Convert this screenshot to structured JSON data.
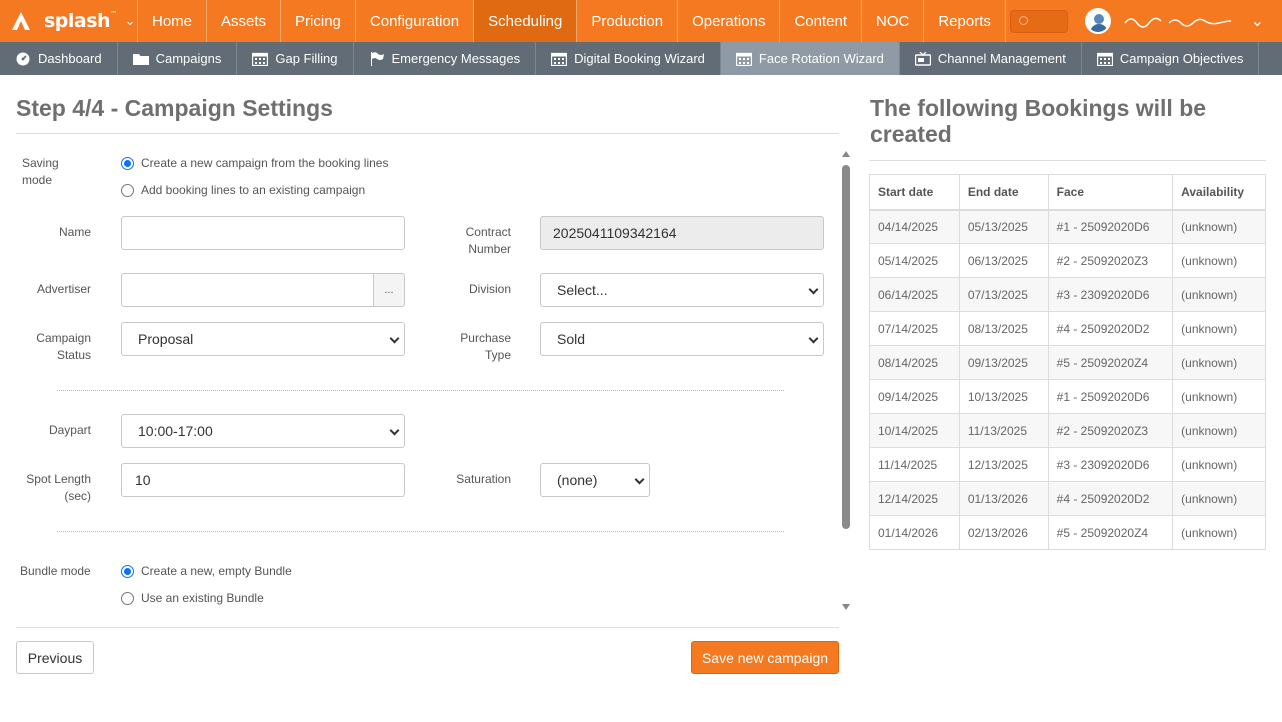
{
  "brand": {
    "name": "splash",
    "trademark": "™"
  },
  "top_nav": [
    "Home",
    "Assets",
    "Pricing",
    "Configuration",
    "Scheduling",
    "Production",
    "Operations",
    "Content",
    "NOC",
    "Reports"
  ],
  "top_nav_active": "Scheduling",
  "sub_nav": [
    {
      "label": "Dashboard",
      "icon": "dashboard-icon"
    },
    {
      "label": "Campaigns",
      "icon": "folder-icon"
    },
    {
      "label": "Gap Filling",
      "icon": "calendar-icon"
    },
    {
      "label": "Emergency Messages",
      "icon": "flag-icon"
    },
    {
      "label": "Digital Booking Wizard",
      "icon": "calendar-icon"
    },
    {
      "label": "Face Rotation Wizard",
      "icon": "calendar-icon"
    },
    {
      "label": "Channel Management",
      "icon": "tv-icon"
    },
    {
      "label": "Campaign Objectives",
      "icon": "calendar-icon"
    }
  ],
  "sub_nav_active": "Face Rotation Wizard",
  "form": {
    "title": "Step 4/4 - Campaign Settings",
    "saving_mode_label": "Saving mode",
    "saving_mode_options": [
      "Create a new campaign from the booking lines",
      "Add booking lines to an existing campaign"
    ],
    "saving_mode_selected": 0,
    "name_label": "Name",
    "name_value": "",
    "contract_number_label_1": "Contract",
    "contract_number_label_2": "Number",
    "contract_number_value": "2025041109342164",
    "advertiser_label": "Advertiser",
    "advertiser_value": "",
    "advertiser_browse": "...",
    "division_label": "Division",
    "division_value": "Select...",
    "campaign_status_label_1": "Campaign",
    "campaign_status_label_2": "Status",
    "campaign_status_value": "Proposal",
    "purchase_type_label_1": "Purchase",
    "purchase_type_label_2": "Type",
    "purchase_type_value": "Sold",
    "daypart_label": "Daypart",
    "daypart_value": "10:00-17:00",
    "spot_length_label_1": "Spot Length",
    "spot_length_label_2": "(sec)",
    "spot_length_value": "10",
    "saturation_label": "Saturation",
    "saturation_value": "(none)",
    "bundle_mode_label": "Bundle mode",
    "bundle_mode_options": [
      "Create a new, empty Bundle",
      "Use an existing Bundle"
    ],
    "bundle_mode_selected": 0,
    "previous_button": "Previous",
    "save_button": "Save new campaign"
  },
  "bookings": {
    "title": "The following Bookings will be created",
    "columns": [
      "Start date",
      "End date",
      "Face",
      "Availability"
    ],
    "rows": [
      [
        "04/14/2025",
        "05/13/2025",
        "#1 - 25092020D6",
        "(unknown)"
      ],
      [
        "05/14/2025",
        "06/13/2025",
        "#2 - 25092020Z3",
        "(unknown)"
      ],
      [
        "06/14/2025",
        "07/13/2025",
        "#3 - 23092020D6",
        "(unknown)"
      ],
      [
        "07/14/2025",
        "08/13/2025",
        "#4 - 25092020D2",
        "(unknown)"
      ],
      [
        "08/14/2025",
        "09/13/2025",
        "#5 - 25092020Z4",
        "(unknown)"
      ],
      [
        "09/14/2025",
        "10/13/2025",
        "#1 - 25092020D6",
        "(unknown)"
      ],
      [
        "10/14/2025",
        "11/13/2025",
        "#2 - 25092020Z3",
        "(unknown)"
      ],
      [
        "11/14/2025",
        "12/13/2025",
        "#3 - 23092020D6",
        "(unknown)"
      ],
      [
        "12/14/2025",
        "01/13/2026",
        "#4 - 25092020D2",
        "(unknown)"
      ],
      [
        "01/14/2026",
        "02/13/2026",
        "#5 - 25092020Z4",
        "(unknown)"
      ]
    ]
  },
  "colors": {
    "brand_orange": "#f47920",
    "subnav_gray": "#616c76",
    "radio_blue": "#0d6efd"
  }
}
